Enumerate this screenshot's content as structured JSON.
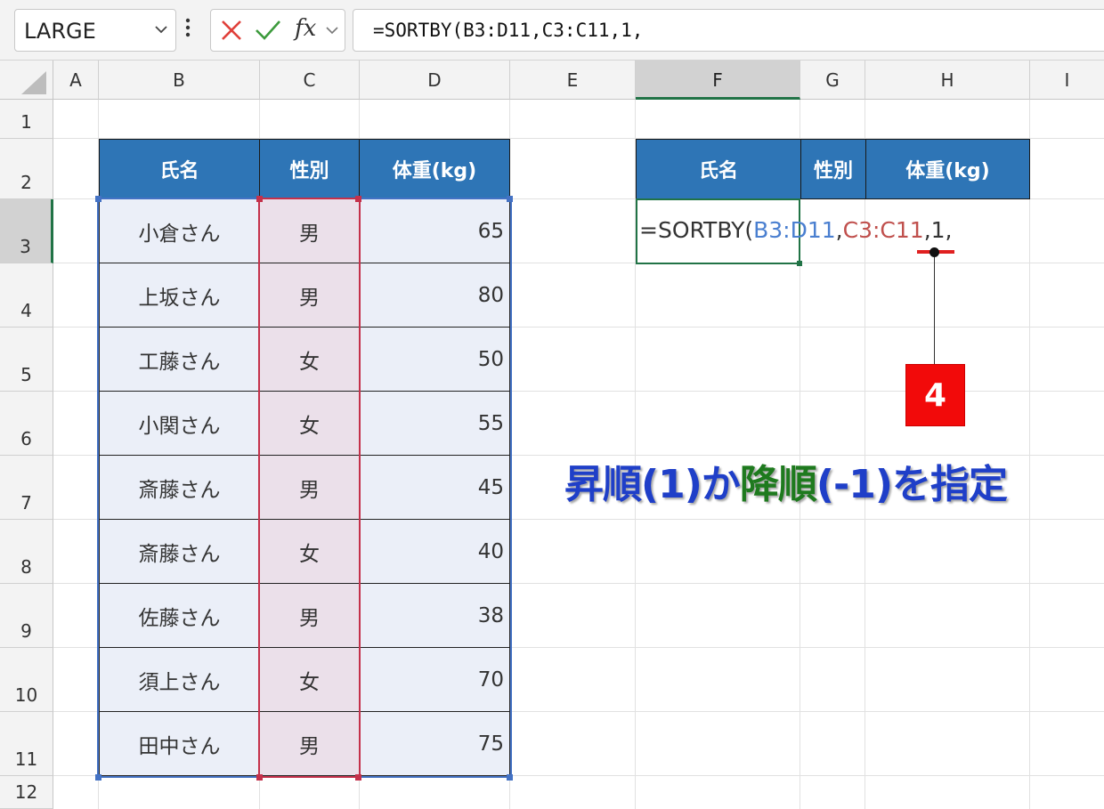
{
  "formula_bar": {
    "name_box": "LARGE",
    "cancel_glyph": "✕",
    "enter_glyph": "✓",
    "fx_label": "fx",
    "formula": "=SORTBY(B3:D11,C3:C11,1,"
  },
  "columns": [
    "A",
    "B",
    "C",
    "D",
    "E",
    "F",
    "G",
    "H",
    "I"
  ],
  "rows": [
    "1",
    "2",
    "3",
    "4",
    "5",
    "6",
    "7",
    "8",
    "9",
    "10",
    "11",
    "12"
  ],
  "source_table": {
    "headers": [
      "氏名",
      "性別",
      "体重(kg)"
    ],
    "rows": [
      {
        "name": "小倉さん",
        "gender": "男",
        "weight": "65"
      },
      {
        "name": "上坂さん",
        "gender": "男",
        "weight": "80"
      },
      {
        "name": "工藤さん",
        "gender": "女",
        "weight": "50"
      },
      {
        "name": "小関さん",
        "gender": "女",
        "weight": "55"
      },
      {
        "name": "斎藤さん",
        "gender": "男",
        "weight": "45"
      },
      {
        "name": "斎藤さん",
        "gender": "女",
        "weight": "40"
      },
      {
        "name": "佐藤さん",
        "gender": "男",
        "weight": "38"
      },
      {
        "name": "須上さん",
        "gender": "女",
        "weight": "70"
      },
      {
        "name": "田中さん",
        "gender": "男",
        "weight": "75"
      }
    ]
  },
  "result_table": {
    "headers": [
      "氏名",
      "性別",
      "体重(kg)"
    ],
    "cell_formula": {
      "prefix": "=SORTBY(",
      "range1": "B3:D11",
      "sep1": ",",
      "range2": "C3:C11",
      "suffix": ",1,"
    }
  },
  "callout": {
    "step": "4",
    "headline": {
      "part1": "昇順",
      "part2": "(1)か",
      "part3": "降順",
      "part4": "(-1)を指定"
    }
  },
  "colors": {
    "header_fill": "#2e75b6",
    "selection_blue": "#4472c4",
    "selection_red": "#c4314b",
    "excel_green": "#217346",
    "headline_blue": "#1f3fc8",
    "headline_green": "#1e7a1e",
    "badge_red": "#f20a0a"
  }
}
